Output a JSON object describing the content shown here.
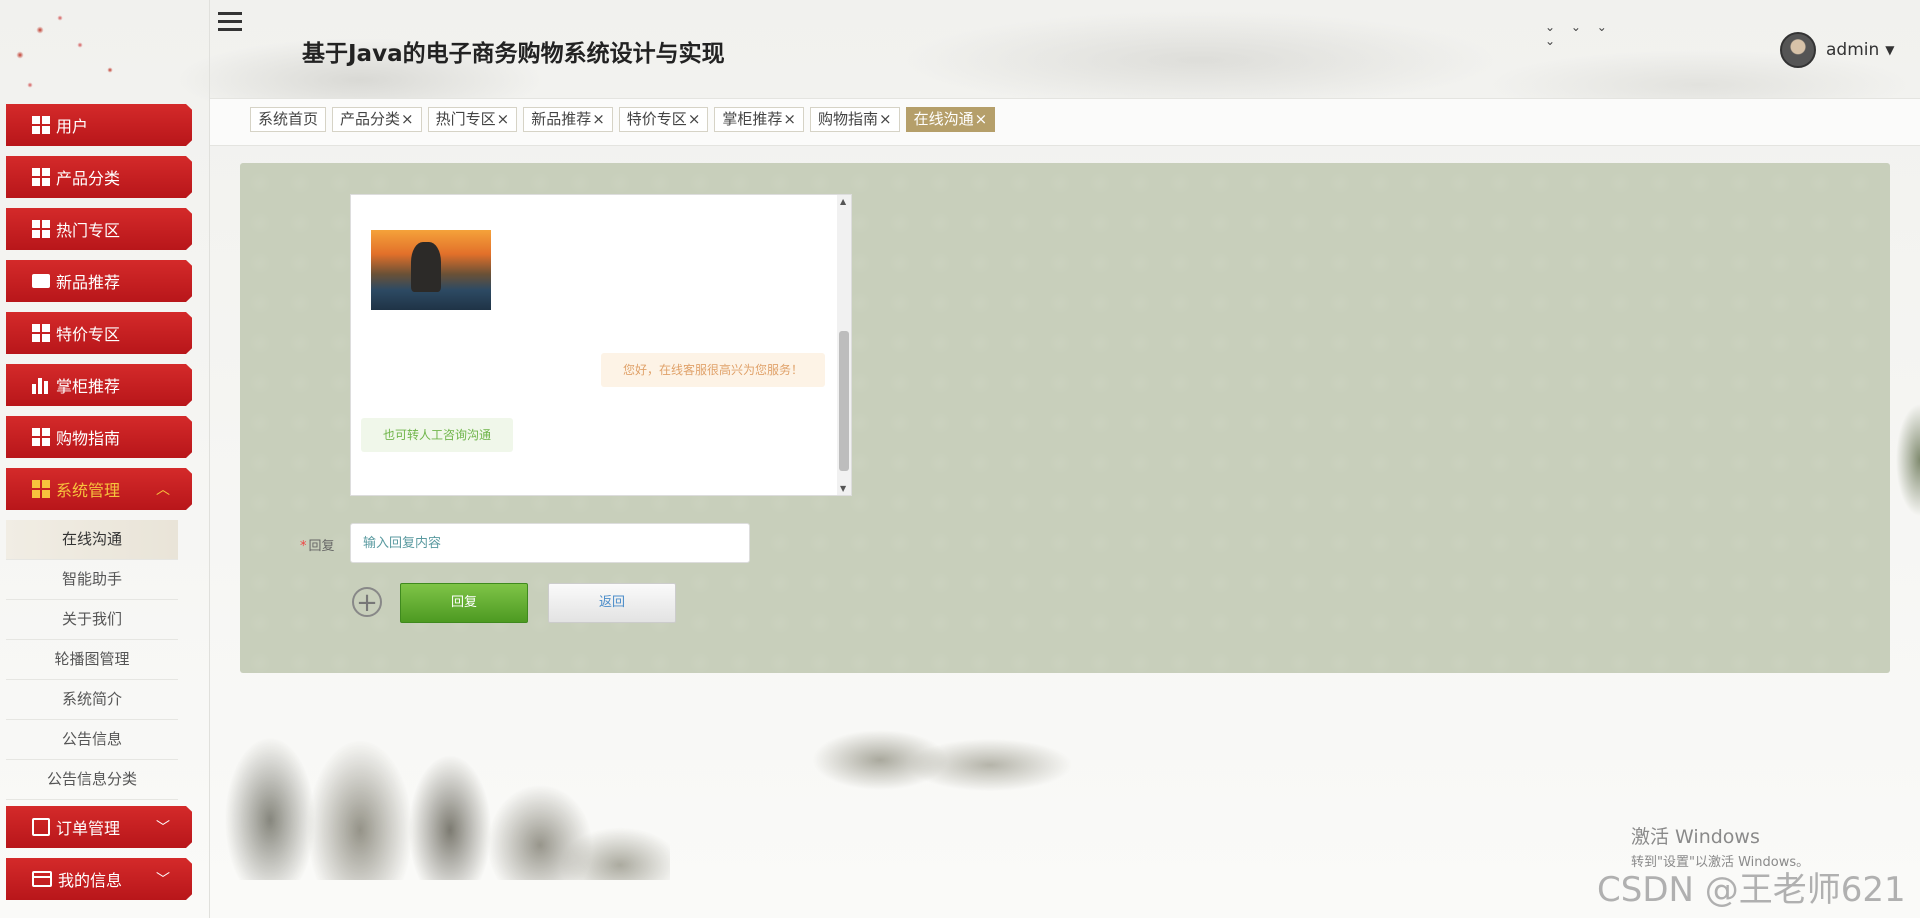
{
  "header": {
    "title": "基于Java的电子商务购物系统设计与实现",
    "user": "admin"
  },
  "sidebar": {
    "items_top": [
      {
        "label": "用户",
        "icon": "grid-icon"
      },
      {
        "label": "产品分类",
        "icon": "grid-icon"
      },
      {
        "label": "热门专区",
        "icon": "grid-icon"
      },
      {
        "label": "新品推荐",
        "icon": "wallet-icon"
      },
      {
        "label": "特价专区",
        "icon": "grid-icon"
      },
      {
        "label": "掌柜推荐",
        "icon": "bar-chart-icon"
      },
      {
        "label": "购物指南",
        "icon": "grid-icon"
      }
    ],
    "system_group": {
      "label": "系统管理",
      "expanded": true,
      "children": [
        "在线沟通",
        "智能助手",
        "关于我们",
        "轮播图管理",
        "系统简介",
        "公告信息",
        "公告信息分类"
      ],
      "selected": "在线沟通"
    },
    "items_bottom": [
      {
        "label": "订单管理",
        "icon": "line-chart-icon"
      },
      {
        "label": "我的信息",
        "icon": "card-icon"
      }
    ]
  },
  "tabs": [
    {
      "label": "系统首页",
      "closable": false
    },
    {
      "label": "产品分类",
      "closable": true
    },
    {
      "label": "热门专区",
      "closable": true
    },
    {
      "label": "新品推荐",
      "closable": true
    },
    {
      "label": "特价专区",
      "closable": true
    },
    {
      "label": "掌柜推荐",
      "closable": true
    },
    {
      "label": "购物指南",
      "closable": true
    },
    {
      "label": "在线沟通",
      "closable": true,
      "active": true
    }
  ],
  "tab_close_glyph": "×",
  "chat": {
    "messages": [
      {
        "side": "right",
        "text": "您好，在线客服很高兴为您服务！"
      },
      {
        "side": "left",
        "text": "也可转人工咨询沟通"
      }
    ]
  },
  "form": {
    "reply_label": "回复",
    "required_mark": "*",
    "reply_placeholder": "输入回复内容",
    "reply_button": "回复",
    "back_button": "返回"
  },
  "colors": {
    "sidebar_red": "#c8201f",
    "active_tab": "#b59f6a",
    "panel_bg": "#c8cfbb",
    "reply_green": "#5fa830"
  },
  "watermarks": {
    "windows_title": "激活 Windows",
    "windows_sub": "转到\"设置\"以激活 Windows。",
    "csdn": "CSDN @王老师621"
  }
}
